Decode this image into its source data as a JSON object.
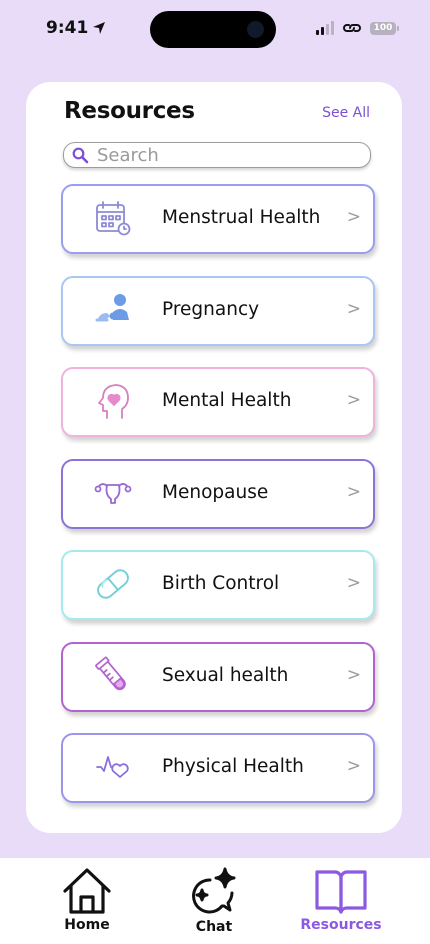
{
  "status_bar": {
    "time": "9:41",
    "battery": "100"
  },
  "resources": {
    "title": "Resources",
    "see_all": "See All",
    "search_placeholder": "Search",
    "items": [
      {
        "label": "Menstrual Health",
        "icon": "calendar-icon",
        "color": "#9a9ef0",
        "chevron": ">"
      },
      {
        "label": "Pregnancy",
        "icon": "pregnancy-icon",
        "color": "#a9c7f2",
        "chevron": ">"
      },
      {
        "label": "Mental Health",
        "icon": "head-heart-icon",
        "color": "#efb3dc",
        "chevron": ">"
      },
      {
        "label": "Menopause",
        "icon": "uterus-icon",
        "color": "#8c73d8",
        "chevron": ">"
      },
      {
        "label": "Birth Control",
        "icon": "pill-icon",
        "color": "#a7eaee",
        "chevron": ">"
      },
      {
        "label": "Sexual health",
        "icon": "test-tube-icon",
        "color": "#b363d0",
        "chevron": ">"
      },
      {
        "label": "Physical Health",
        "icon": "heartbeat-icon",
        "color": "#9b95ec",
        "chevron": ">"
      }
    ]
  },
  "tab_bar": {
    "tabs": [
      {
        "label": "Home",
        "icon": "home-icon"
      },
      {
        "label": "Chat",
        "icon": "chat-sparkle-icon"
      },
      {
        "label": "Resources",
        "icon": "book-icon"
      }
    ],
    "active": "Resources",
    "active_color": "#8c59e0"
  },
  "colors": {
    "background": "#e8dcf8",
    "accent": "#7b4fd6"
  }
}
